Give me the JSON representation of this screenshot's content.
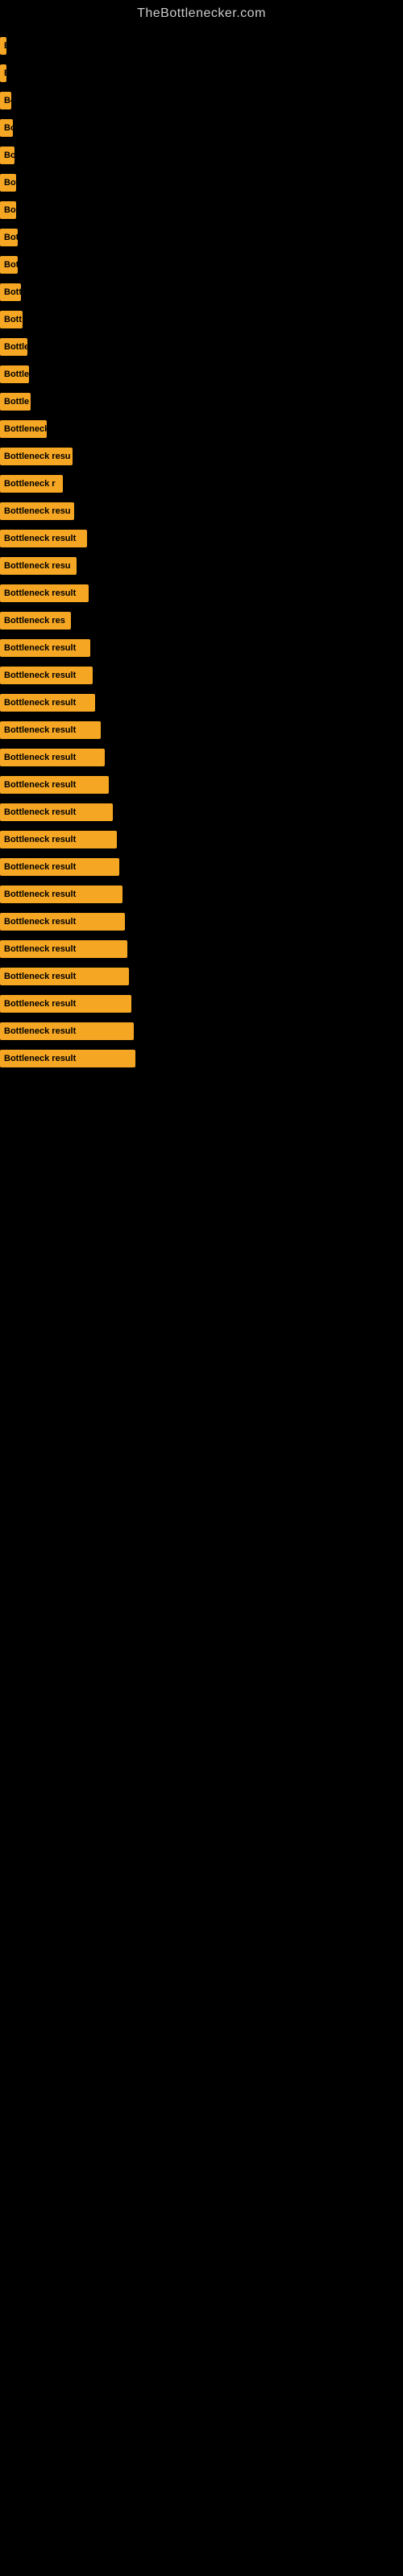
{
  "site": {
    "title": "TheBottlenecker.com"
  },
  "bars": [
    {
      "label": "B",
      "width": 8
    },
    {
      "label": "B",
      "width": 8
    },
    {
      "label": "Bo",
      "width": 14
    },
    {
      "label": "Bo",
      "width": 16
    },
    {
      "label": "Bo",
      "width": 18
    },
    {
      "label": "Bot",
      "width": 20
    },
    {
      "label": "Bo",
      "width": 20
    },
    {
      "label": "Bot",
      "width": 22
    },
    {
      "label": "Bot",
      "width": 22
    },
    {
      "label": "Bott",
      "width": 26
    },
    {
      "label": "Bott",
      "width": 28
    },
    {
      "label": "Bottle",
      "width": 34
    },
    {
      "label": "Bottle",
      "width": 36
    },
    {
      "label": "Bottle",
      "width": 38
    },
    {
      "label": "Bottleneck",
      "width": 58
    },
    {
      "label": "Bottleneck resu",
      "width": 90
    },
    {
      "label": "Bottleneck r",
      "width": 78
    },
    {
      "label": "Bottleneck resu",
      "width": 92
    },
    {
      "label": "Bottleneck result",
      "width": 108
    },
    {
      "label": "Bottleneck resu",
      "width": 95
    },
    {
      "label": "Bottleneck result",
      "width": 110
    },
    {
      "label": "Bottleneck res",
      "width": 88
    },
    {
      "label": "Bottleneck result",
      "width": 112
    },
    {
      "label": "Bottleneck result",
      "width": 115
    },
    {
      "label": "Bottleneck result",
      "width": 118
    },
    {
      "label": "Bottleneck result",
      "width": 125
    },
    {
      "label": "Bottleneck result",
      "width": 130
    },
    {
      "label": "Bottleneck result",
      "width": 135
    },
    {
      "label": "Bottleneck result",
      "width": 140
    },
    {
      "label": "Bottleneck result",
      "width": 145
    },
    {
      "label": "Bottleneck result",
      "width": 148
    },
    {
      "label": "Bottleneck result",
      "width": 152
    },
    {
      "label": "Bottleneck result",
      "width": 155
    },
    {
      "label": "Bottleneck result",
      "width": 158
    },
    {
      "label": "Bottleneck result",
      "width": 160
    },
    {
      "label": "Bottleneck result",
      "width": 163
    },
    {
      "label": "Bottleneck result",
      "width": 166
    },
    {
      "label": "Bottleneck result",
      "width": 168
    }
  ]
}
